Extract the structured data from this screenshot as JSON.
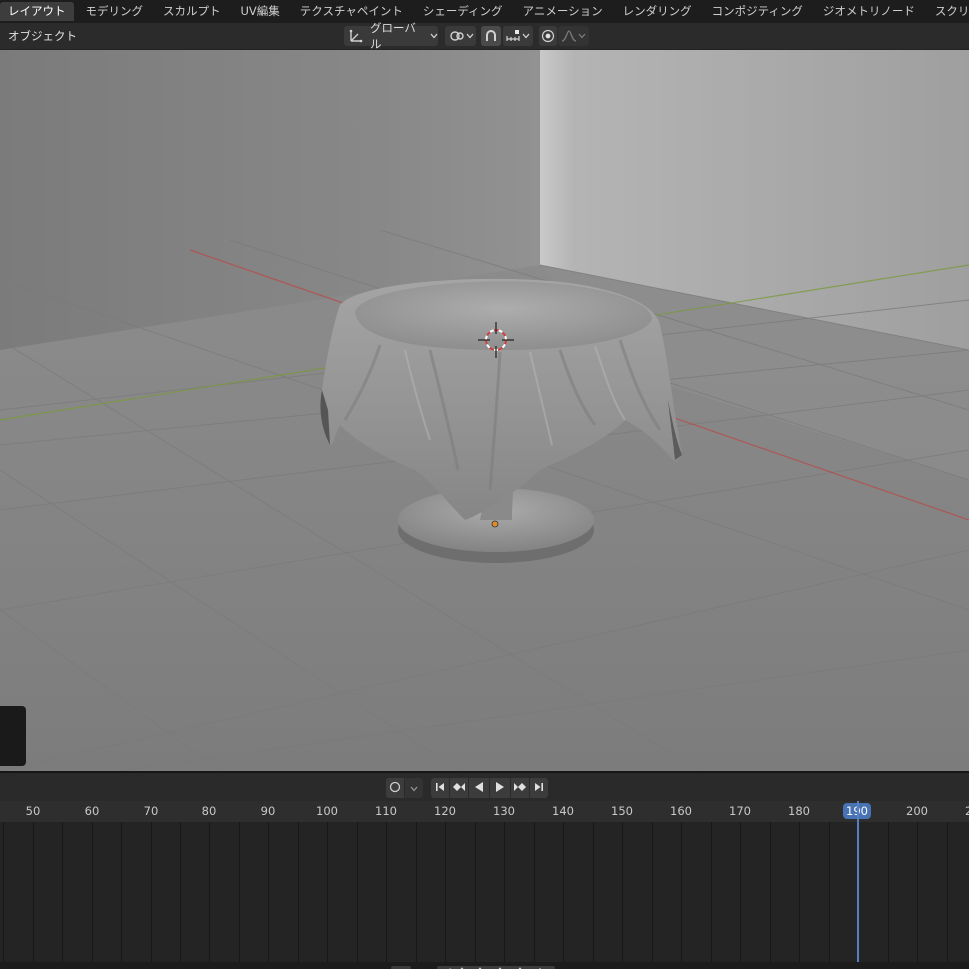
{
  "workspace_tabs": [
    {
      "label": "レイアウト",
      "active": true
    },
    {
      "label": "モデリング"
    },
    {
      "label": "スカルプト"
    },
    {
      "label": "UV編集"
    },
    {
      "label": "テクスチャペイント"
    },
    {
      "label": "シェーディング"
    },
    {
      "label": "アニメーション"
    },
    {
      "label": "レンダリング"
    },
    {
      "label": "コンポジティング"
    },
    {
      "label": "ジオメトリノード"
    },
    {
      "label": "スクリプト作"
    }
  ],
  "viewport_header": {
    "mode_label": "オブジェクト",
    "transform_orientation": "グローバル"
  },
  "timeline": {
    "frame_ticks": [
      "50",
      "60",
      "70",
      "80",
      "90",
      "100",
      "110",
      "120",
      "130",
      "140",
      "150",
      "160",
      "170",
      "180",
      "190",
      "200",
      "2"
    ],
    "current_frame": "190"
  },
  "colors": {
    "accent": "#4772b3",
    "x_axis": "#b84b4b",
    "y_axis": "#7a9a3c"
  },
  "icons": {
    "orientation": "axes-icon",
    "pivot": "pivot-icon",
    "snap": "magnet-icon",
    "snap_target": "snap-increment-icon",
    "proportional": "proportional-edit-icon",
    "falloff": "falloff-curve-icon",
    "playback": [
      "jump-start-icon",
      "prev-keyframe-icon",
      "play-reverse-icon",
      "play-icon",
      "next-keyframe-icon",
      "jump-end-icon"
    ]
  }
}
